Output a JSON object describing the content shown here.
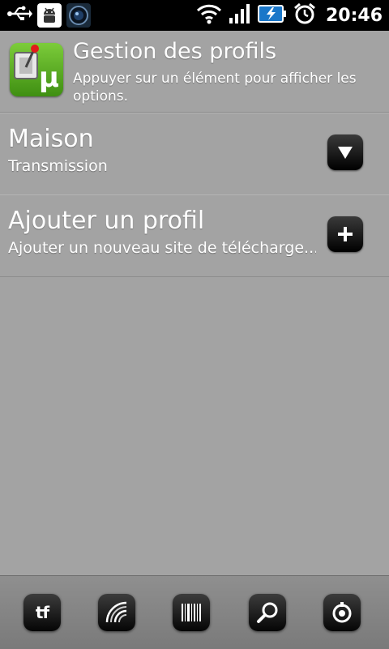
{
  "status_bar": {
    "time": "20:46",
    "icons": [
      "usb-icon",
      "android-debug-icon",
      "camera-app-icon",
      "wifi-icon",
      "signal-icon",
      "battery-charging-icon",
      "alarm-icon"
    ]
  },
  "header": {
    "app_icon": "utorrent-remote-icon",
    "title": "Gestion des profils",
    "subtitle": "Appuyer sur un élément pour afficher les options."
  },
  "profiles": [
    {
      "title": "Maison",
      "subtitle": "Transmission",
      "action_icon": "dropdown-arrow-icon"
    },
    {
      "title": "Ajouter un profil",
      "subtitle": "Ajouter un nouveau site de télécharge...",
      "action_icon": "add-icon"
    }
  ],
  "toolbar": {
    "buttons": [
      "torrent-files-icon",
      "rss-feed-icon",
      "barcode-scan-icon",
      "search-icon",
      "settings-icon"
    ],
    "tf_label": "tf"
  },
  "colors": {
    "background": "#a3a3a3",
    "statusbar": "#000000",
    "button": "#000000",
    "app_icon_green": "#5aad22"
  }
}
